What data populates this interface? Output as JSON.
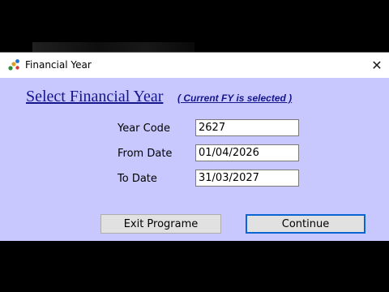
{
  "window": {
    "title": "Financial Year",
    "close_glyph": "✕",
    "background_color": "#c8c8ff",
    "accent_color": "#16168c"
  },
  "form": {
    "heading": "Select Financial Year",
    "note": "( Current FY is selected )",
    "year_code_label": "Year Code",
    "year_code_value": "2627",
    "from_date_label": "From Date",
    "from_date_value": "01/04/2026",
    "to_date_label": "To Date",
    "to_date_value": "31/03/2027"
  },
  "buttons": {
    "exit_label": "Exit Programe",
    "continue_label": "Continue"
  },
  "icons": [
    "app-icon",
    "close-icon"
  ]
}
